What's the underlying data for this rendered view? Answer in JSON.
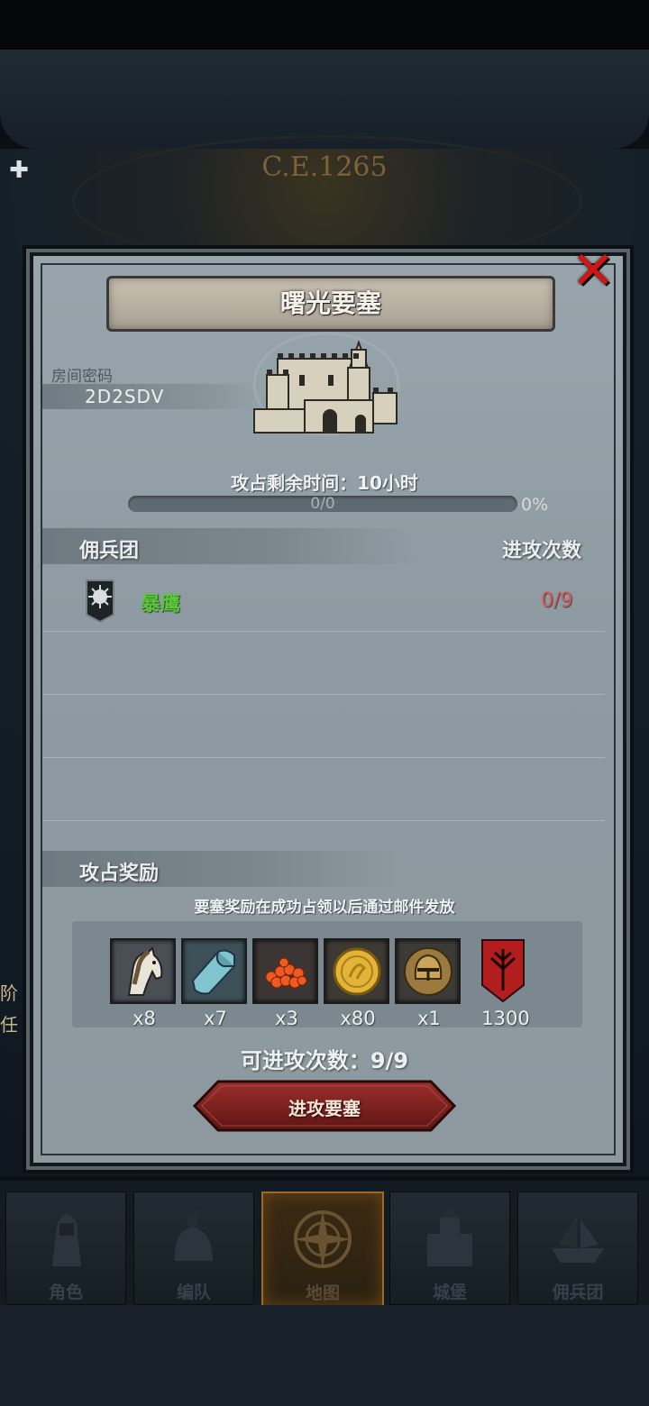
{
  "background": {
    "era_text": "C.E.1265"
  },
  "modal": {
    "title": "曙光要塞",
    "room_password_label": "房间密码",
    "room_password_value": "2D2SDV",
    "capture_time_text": "攻占剩余时间：10小时",
    "progress": {
      "text": "0/0",
      "percent_text": "0%",
      "fraction": 0.0
    },
    "mercenary_section": {
      "title": "佣兵团",
      "attacks_header": "进攻次数",
      "rows": [
        {
          "name": "暴鹰",
          "attacks": "0/9"
        }
      ]
    },
    "reward_section": {
      "title": "攻占奖励",
      "note": "要塞奖励在成功占领以后通过邮件发放",
      "items": [
        {
          "icon": "horse-icon",
          "count": "x8"
        },
        {
          "icon": "cloth-icon",
          "count": "x7"
        },
        {
          "icon": "berries-icon",
          "count": "x3"
        },
        {
          "icon": "gold-coin-icon",
          "count": "x80"
        },
        {
          "icon": "helmet-icon",
          "count": "x1"
        },
        {
          "icon": "crest-banner-icon",
          "count": "1300"
        }
      ]
    },
    "attack_count_text": "可进攻次数：9/9",
    "attack_button_label": "进攻要塞"
  },
  "side_left": [
    "阶",
    "任"
  ],
  "nav": {
    "tabs": [
      {
        "label": "角色",
        "icon": "knight-icon",
        "active": false
      },
      {
        "label": "编队",
        "icon": "helmet-plume-icon",
        "active": false
      },
      {
        "label": "地图",
        "icon": "compass-icon",
        "active": true
      },
      {
        "label": "城堡",
        "icon": "castle-icon",
        "active": false
      },
      {
        "label": "佣兵团",
        "icon": "mercenary-ship-icon",
        "active": false
      }
    ]
  },
  "colors": {
    "accent_red": "#d01515",
    "name_green": "#5ac73a",
    "attacks_red": "#d85a5a",
    "nav_active_border": "#9b6a2b"
  }
}
